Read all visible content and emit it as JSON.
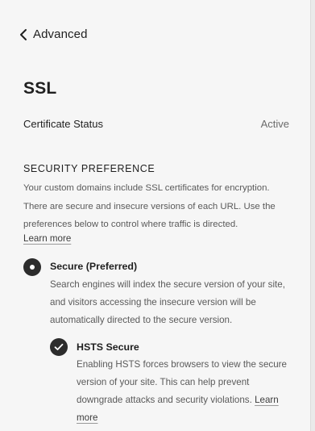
{
  "nav": {
    "back_label": "Advanced"
  },
  "page": {
    "title": "SSL"
  },
  "certificate": {
    "label": "Certificate Status",
    "value": "Active"
  },
  "security_preference": {
    "heading": "SECURITY PREFERENCE",
    "description": "Your custom domains include SSL certificates for encryption. There are secure and insecure versions of each URL. Use the preferences below to control where traffic is directed.",
    "learn_more": "Learn more",
    "options": [
      {
        "title": "Secure (Preferred)",
        "description": "Search engines will index the secure version of your site, and visitors accessing the insecure version will be automatically directed to the secure version.",
        "selected": true
      }
    ],
    "hsts": {
      "title": "HSTS Secure",
      "description": "Enabling HSTS forces browsers to view the secure version of your site. This can help prevent downgrade attacks and security violations.",
      "learn_more": "Learn more",
      "checked": true
    }
  },
  "colors": {
    "background": "#f6f6f6",
    "control_fill": "#2c2c2c",
    "muted_text": "#5a5a5a"
  },
  "icons": {
    "back": "chevron-left-icon",
    "radio": "radio-selected-icon",
    "check": "checkmark-icon"
  }
}
